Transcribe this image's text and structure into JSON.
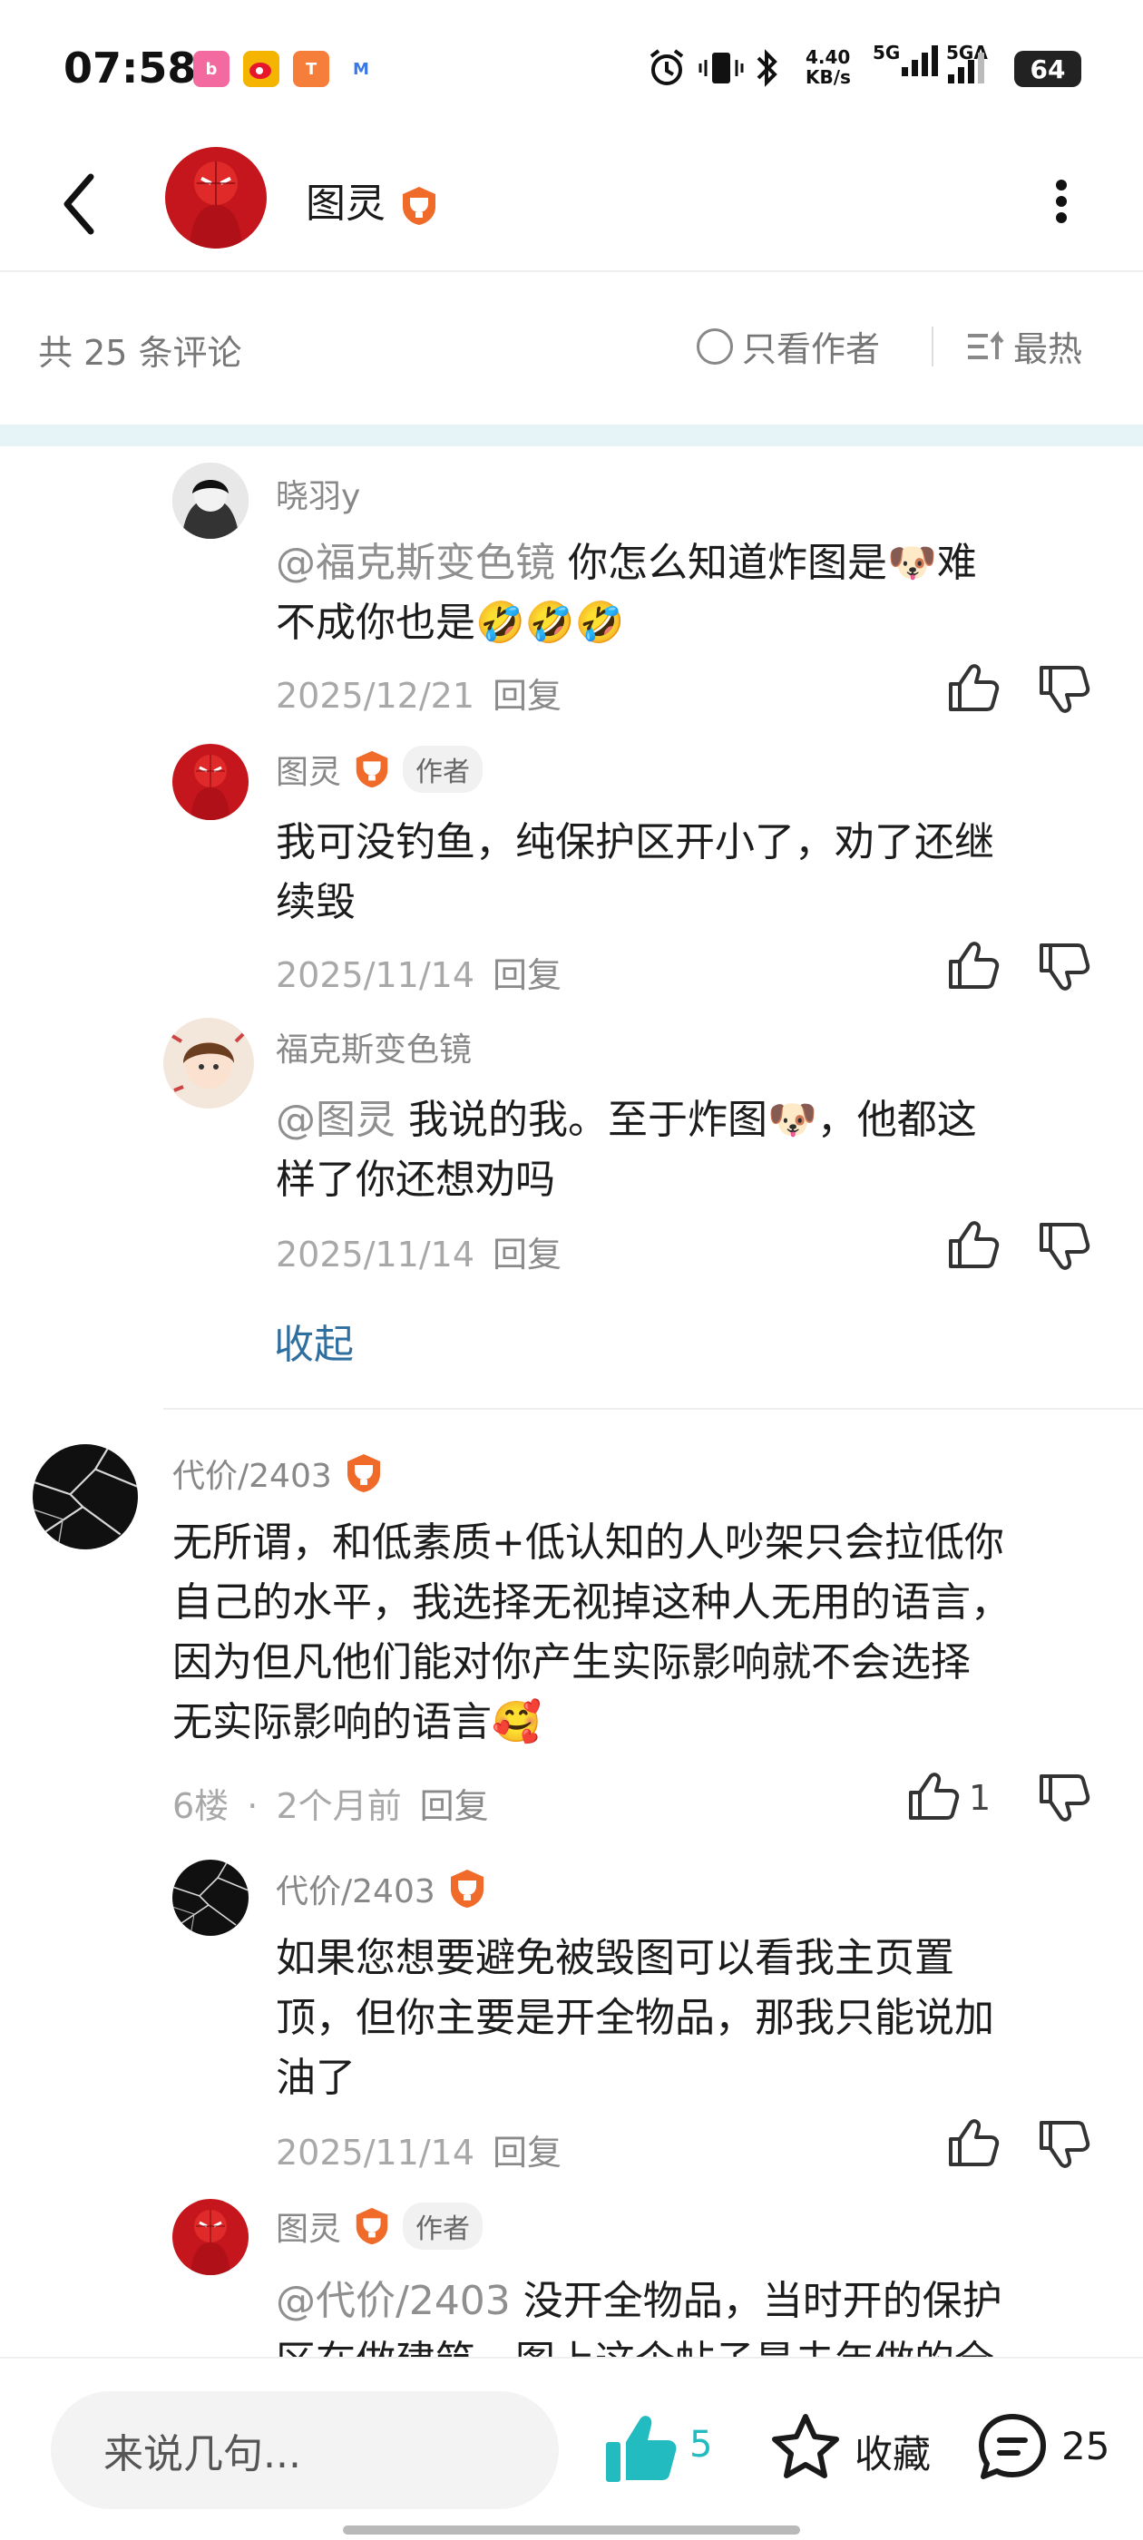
{
  "status_bar": {
    "time": "07:58",
    "net_speed_value": "4.40",
    "net_speed_unit": "KB/s",
    "signal1": "5G",
    "signal2": "5GA",
    "battery": "64",
    "notif_icons": [
      "bilibili-icon",
      "weibo-icon",
      "orange-app-icon",
      "mail-icon"
    ]
  },
  "header": {
    "name": "图灵"
  },
  "filter": {
    "count_label": "共 25 条评论",
    "only_author_label": "只看作者",
    "sort_label": "最热"
  },
  "replies": [
    {
      "user": "晓羽y",
      "mention": "@福克斯变色镜",
      "line1": " 你怎么知道炸图是🐶难",
      "line2": "不成你也是🤣🤣🤣",
      "date": "2025/12/21",
      "reply_label": "回复"
    },
    {
      "user": "图灵",
      "tag": "作者",
      "line1": "我可没钓鱼，纯保护区开小了，劝了还继",
      "line2": "续毁",
      "date": "2025/11/14",
      "reply_label": "回复"
    },
    {
      "user": "福克斯变色镜",
      "mention": "@图灵",
      "line1": " 我说的我。至于炸图🐶，他都这",
      "line2": "样了你还想劝吗",
      "date": "2025/11/14",
      "reply_label": "回复"
    }
  ],
  "collapse_label": "收起",
  "main_comment": {
    "user": "代价/2403",
    "lines": [
      "无所谓，和低素质+低认知的人吵架只会拉低你",
      "自己的水平，我选择无视掉这种人无用的语言，",
      "因为但凡他们能对你产生实际影响就不会选择",
      "无实际影响的语言🥰"
    ],
    "floor": "6楼",
    "dot": "·",
    "time": "2个月前",
    "reply_label": "回复",
    "likes": "1"
  },
  "sub_replies": [
    {
      "user": "代价/2403",
      "lines": [
        "如果您想要避免被毁图可以看我主页置",
        "顶，但你主要是开全物品，那我只能说加",
        "油了"
      ],
      "date": "2025/11/14",
      "reply_label": "回复"
    },
    {
      "user": "图灵",
      "tag": "作者",
      "mention": "@代价/2403",
      "line1": " 没开全物品，当时开的保护",
      "line2": "区在做建筑，图上这个帖子是去年做的全"
    }
  ],
  "bottom_bar": {
    "input_placeholder": "来说几句...",
    "like_count": "5",
    "favorite_label": "收藏",
    "comment_count": "25"
  },
  "colors": {
    "accent_teal": "#22bbc0",
    "link_blue": "#2f6f9f",
    "medal_orange": "#f06a2a",
    "band": "#e7f4f7"
  }
}
